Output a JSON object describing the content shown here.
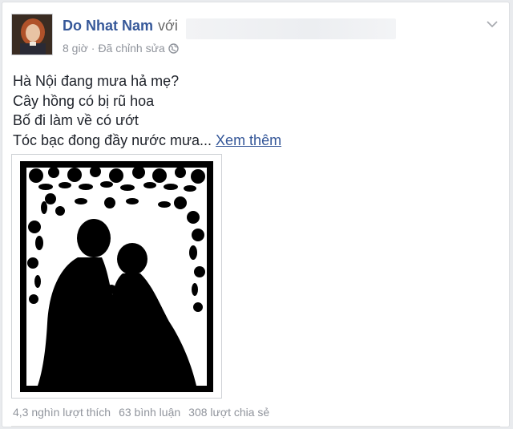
{
  "post": {
    "author": "Do Nhat Nam",
    "with_label": "với",
    "time": "8 giờ",
    "separator": "·",
    "edited": "Đã chỉnh sửa",
    "audience_icon": "globe-icon",
    "options_icon": "chevron-down-icon",
    "text_lines": [
      "Hà Nội đang mưa hả mẹ?",
      "Cây hồng có bị rũ hoa",
      "Bố đi làm về có ướt",
      "Tóc bạc đong đầy nước mưa..."
    ],
    "see_more": "Xem thêm",
    "photo": "silhouette-papercut-mother-child",
    "stats": {
      "likes": "4,3 nghìn lượt thích",
      "comments": "63 bình luận",
      "shares": "308 lượt chia sẻ"
    }
  },
  "colors": {
    "link": "#365899",
    "meta": "#90949c",
    "text": "#1d2129",
    "background": "#e9ebee"
  }
}
